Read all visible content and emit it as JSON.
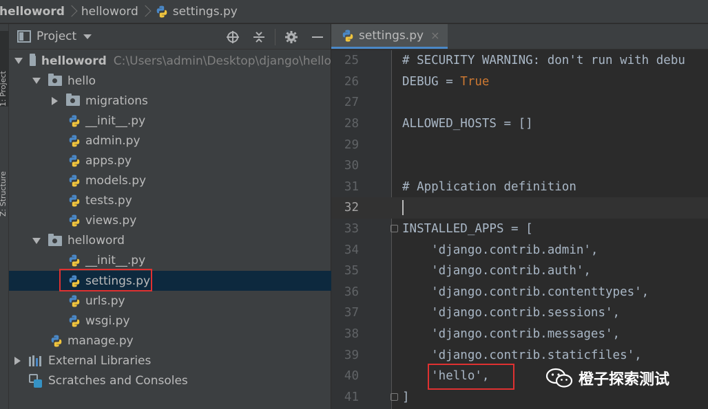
{
  "breadcrumb": {
    "items": [
      "helloword",
      "helloword",
      "settings.py"
    ]
  },
  "tool_strip": {
    "project_tab": "1: Project",
    "structure_tab": "Z: Structure"
  },
  "project_panel": {
    "title": "Project",
    "icons": [
      "crosshair-icon",
      "collapse-icon",
      "gear-icon",
      "minimize-icon"
    ],
    "tree": [
      {
        "label": "helloword",
        "path": "C:\\Users\\admin\\Desktop\\django\\hello",
        "type": "root-folder",
        "expanded": true
      },
      {
        "label": "hello",
        "type": "package",
        "expanded": true
      },
      {
        "label": "migrations",
        "type": "package",
        "expanded": false
      },
      {
        "label": "__init__.py",
        "type": "python-file"
      },
      {
        "label": "admin.py",
        "type": "python-file"
      },
      {
        "label": "apps.py",
        "type": "python-file"
      },
      {
        "label": "models.py",
        "type": "python-file"
      },
      {
        "label": "tests.py",
        "type": "python-file"
      },
      {
        "label": "views.py",
        "type": "python-file"
      },
      {
        "label": "helloword",
        "type": "package",
        "expanded": true
      },
      {
        "label": "__init__.py",
        "type": "python-file"
      },
      {
        "label": "settings.py",
        "type": "python-file",
        "selected": true
      },
      {
        "label": "urls.py",
        "type": "python-file"
      },
      {
        "label": "wsgi.py",
        "type": "python-file"
      },
      {
        "label": "manage.py",
        "type": "python-file"
      },
      {
        "label": "External Libraries",
        "type": "libraries",
        "expanded": false
      },
      {
        "label": "Scratches and Consoles",
        "type": "scratches"
      }
    ]
  },
  "editor": {
    "tab_label": "settings.py",
    "tab_close": "×",
    "current_line": 32,
    "lines": [
      {
        "num": "25",
        "text": "# SECURITY WARNING: don't run with debu"
      },
      {
        "num": "26",
        "text": "DEBUG = True"
      },
      {
        "num": "27",
        "text": ""
      },
      {
        "num": "28",
        "text": "ALLOWED_HOSTS = []"
      },
      {
        "num": "29",
        "text": ""
      },
      {
        "num": "30",
        "text": ""
      },
      {
        "num": "31",
        "text": "# Application definition"
      },
      {
        "num": "32",
        "text": ""
      },
      {
        "num": "33",
        "text": "INSTALLED_APPS = ["
      },
      {
        "num": "34",
        "text": "    'django.contrib.admin',"
      },
      {
        "num": "35",
        "text": "    'django.contrib.auth',"
      },
      {
        "num": "36",
        "text": "    'django.contrib.contenttypes',"
      },
      {
        "num": "37",
        "text": "    'django.contrib.sessions',"
      },
      {
        "num": "38",
        "text": "    'django.contrib.messages',"
      },
      {
        "num": "39",
        "text": "    'django.contrib.staticfiles',"
      },
      {
        "num": "40",
        "text": "    'hello',"
      },
      {
        "num": "41",
        "text": "]"
      }
    ]
  },
  "watermark": {
    "text": "橙子探索测试"
  },
  "colors": {
    "keyword": "#cc7832",
    "string": "#6a8759",
    "comment": "#808080",
    "selection": "#0d293e",
    "highlight_box": "#e03131",
    "tab_underline": "#4a88c7"
  }
}
